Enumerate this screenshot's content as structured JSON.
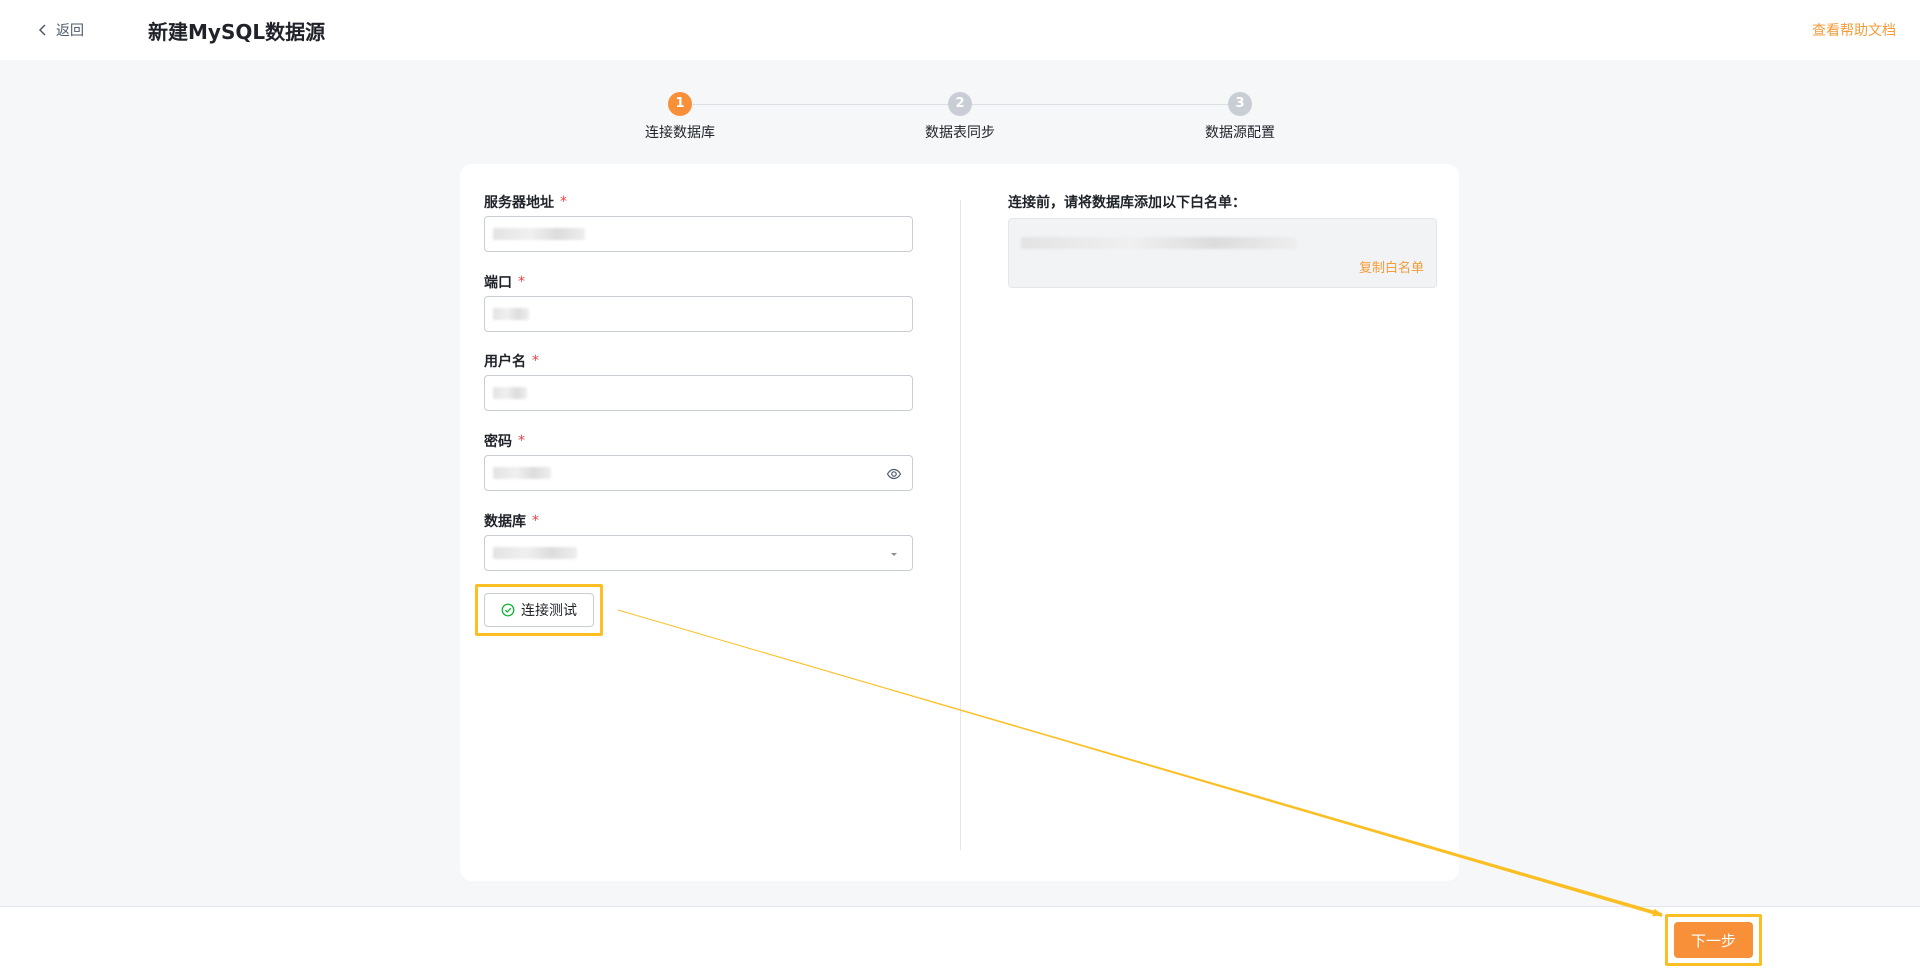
{
  "header": {
    "back_label": "返回",
    "title": "新建MySQL数据源",
    "help_link": "查看帮助文档"
  },
  "stepper": {
    "steps": [
      {
        "number": "1",
        "label": "连接数据库",
        "status": "active"
      },
      {
        "number": "2",
        "label": "数据表同步",
        "status": "pending"
      },
      {
        "number": "3",
        "label": "数据源配置",
        "status": "pending"
      }
    ]
  },
  "form": {
    "required_mark": "*",
    "host": {
      "label": "服务器地址"
    },
    "port": {
      "label": "端口"
    },
    "username": {
      "label": "用户名"
    },
    "password": {
      "label": "密码"
    },
    "database": {
      "label": "数据库"
    },
    "test_button": "连接测试"
  },
  "whitelist": {
    "title": "连接前，请将数据库添加以下白名单：",
    "copy_label": "复制白名单"
  },
  "footer": {
    "next_button": "下一步"
  },
  "colors": {
    "accent": "#f8903a",
    "link": "#f39c39",
    "highlight": "#fbbf24",
    "required": "#f53f3f"
  }
}
